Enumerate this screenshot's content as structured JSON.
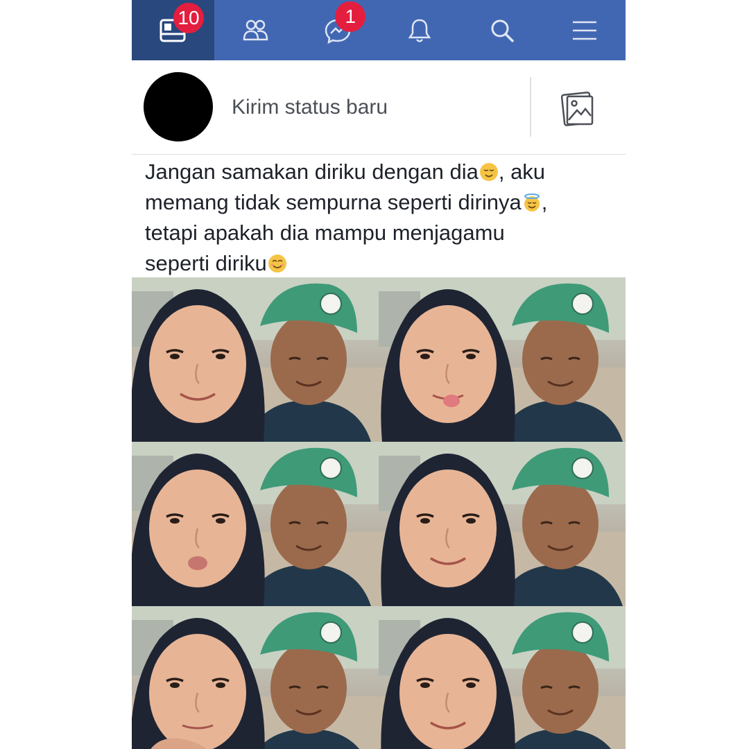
{
  "nav": {
    "items": [
      {
        "name": "home",
        "icon": "news-feed-icon",
        "badge": "10",
        "active": true
      },
      {
        "name": "friends",
        "icon": "friends-icon",
        "badge": null
      },
      {
        "name": "messages",
        "icon": "messenger-icon",
        "badge": "1"
      },
      {
        "name": "notifications",
        "icon": "bell-icon",
        "badge": null
      },
      {
        "name": "search",
        "icon": "search-icon",
        "badge": null
      },
      {
        "name": "menu",
        "icon": "hamburger-menu-icon",
        "badge": null
      }
    ],
    "colors": {
      "bar": "#4267b2",
      "active": "#29487d",
      "badge": "#e41e3f"
    }
  },
  "composer": {
    "placeholder": "Kirim status baru",
    "photo_icon": "photo-icon"
  },
  "post": {
    "lines": [
      {
        "text": "Jangan samakan diriku dengan dia",
        "emoji": "relieved-face-emoji",
        "after": ", aku"
      },
      {
        "text": "memang tidak sempurna seperti dirinya",
        "emoji": "smiling-face-with-halo-emoji",
        "after": ","
      },
      {
        "text": "tetapi apakah dia mampu menjagamu",
        "emoji": null,
        "after": ""
      },
      {
        "text": "seperti diriku",
        "emoji": "smiling-face-emoji",
        "after": ""
      }
    ]
  },
  "photos": {
    "count": 6,
    "subject": "selfie of two people, one in a dark hijab and one in a green cap"
  }
}
